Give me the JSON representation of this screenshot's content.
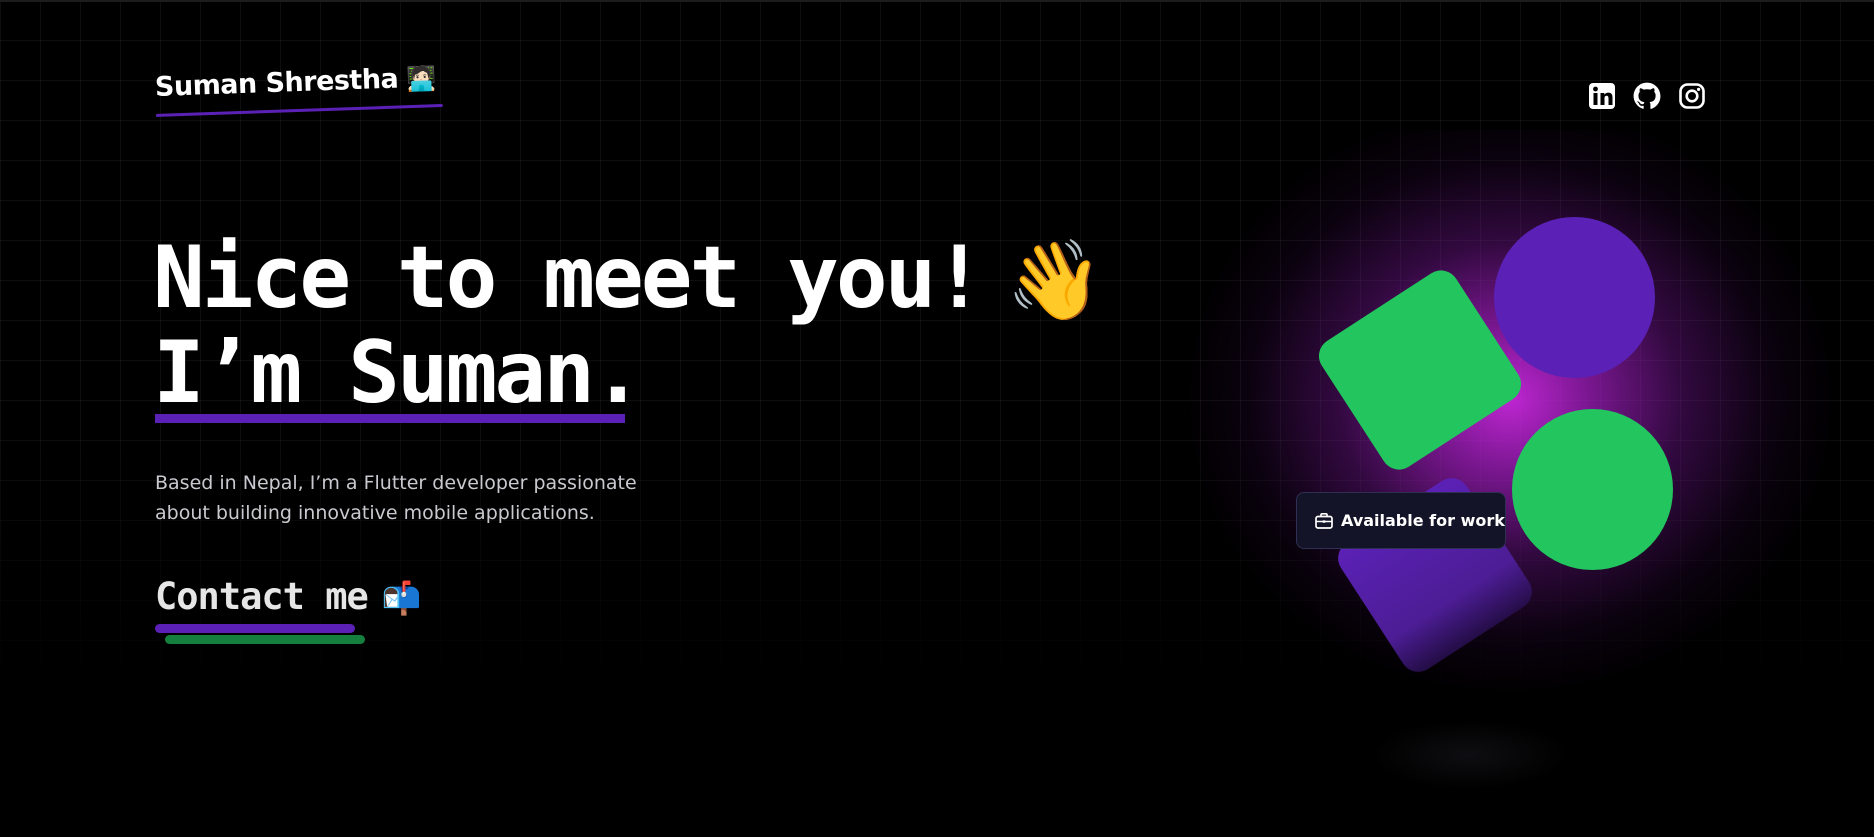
{
  "header": {
    "logo_text": "Suman Shrestha",
    "logo_emoji": "🧑🏻‍💻",
    "social_icons": [
      "linkedin-icon",
      "github-icon",
      "instagram-icon"
    ]
  },
  "hero": {
    "line1": "Nice to meet you!",
    "wave_emoji": "👋",
    "line2": "I’m Suman.",
    "bio": "Based in Nepal, I’m a Flutter developer passionate about building innovative mobile applications.",
    "contact_label": "Contact me",
    "contact_emoji": "📬"
  },
  "badge": {
    "label": "Available for work",
    "icon": "briefcase-icon"
  },
  "colors": {
    "background": "#000000",
    "purple": "#5b21b6",
    "green": "#22c55e",
    "dark_green": "#15803d",
    "glow": "#c828dc"
  }
}
